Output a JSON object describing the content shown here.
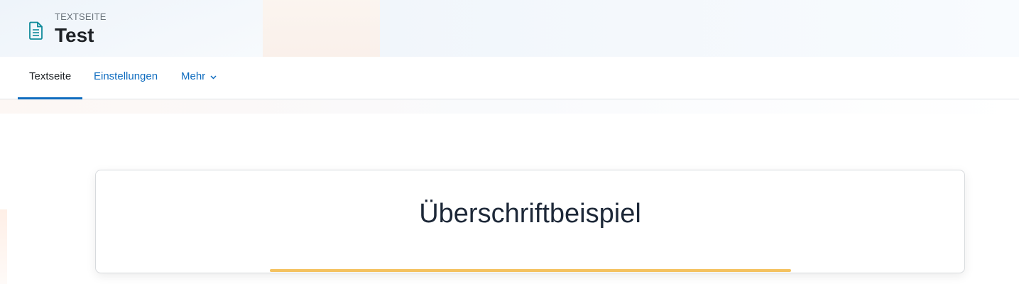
{
  "header": {
    "overline": "TEXTSEITE",
    "title": "Test",
    "icon": "document-icon",
    "icon_color": "#0f8b9b"
  },
  "tabs": [
    {
      "label": "Textseite",
      "active": true
    },
    {
      "label": "Einstellungen",
      "active": false
    },
    {
      "label": "Mehr",
      "active": false,
      "has_dropdown": true
    }
  ],
  "content": {
    "heading": "Überschriftbeispiel",
    "accent_color": "#f4c260"
  },
  "colors": {
    "link": "#0f6cbf",
    "text": "#1d2125"
  }
}
